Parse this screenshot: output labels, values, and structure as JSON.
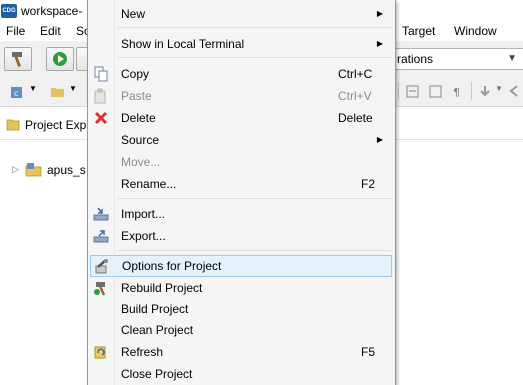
{
  "window": {
    "title": "workspace-"
  },
  "menubar": {
    "items": [
      "File",
      "Edit",
      "So"
    ],
    "right_items": [
      "Target",
      "Window"
    ]
  },
  "toolbar": {
    "launch_combo_text": "rations"
  },
  "explorer": {
    "tab_label": "Project Exp",
    "project_label": "apus_s"
  },
  "context_menu": {
    "items": [
      {
        "label": "New",
        "submenu": true
      },
      {
        "label": "Show in Local Terminal",
        "submenu": true
      },
      {
        "label": "Copy",
        "shortcut": "Ctrl+C"
      },
      {
        "label": "Paste",
        "shortcut": "Ctrl+V",
        "disabled": true
      },
      {
        "label": "Delete",
        "shortcut": "Delete"
      },
      {
        "label": "Source",
        "submenu": true
      },
      {
        "label": "Move...",
        "disabled": true
      },
      {
        "label": "Rename...",
        "shortcut": "F2"
      },
      {
        "label": "Import..."
      },
      {
        "label": "Export..."
      },
      {
        "label": "Options for Project",
        "highlighted": true
      },
      {
        "label": "Rebuild Project"
      },
      {
        "label": "Build Project"
      },
      {
        "label": "Clean Project"
      },
      {
        "label": "Refresh",
        "shortcut": "F5"
      },
      {
        "label": "Close Project"
      }
    ]
  },
  "colors": {
    "highlight_bg": "#e5f1fb",
    "highlight_border": "#9dc8f2",
    "delete_icon": "#d9302a",
    "disabled_text": "#8d8d8d"
  }
}
